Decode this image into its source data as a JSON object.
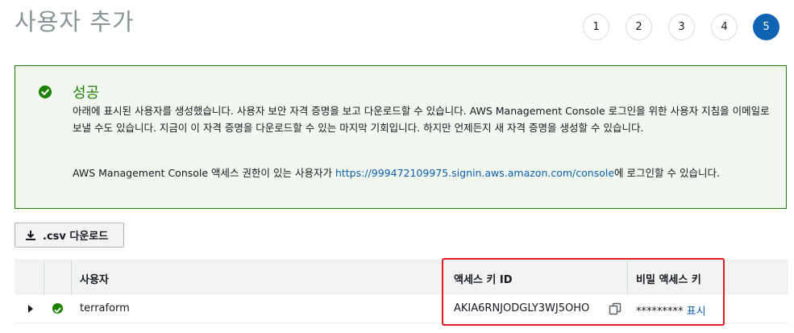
{
  "header": {
    "title": "사용자 추가"
  },
  "steps": [
    {
      "label": "1",
      "active": false
    },
    {
      "label": "2",
      "active": false
    },
    {
      "label": "3",
      "active": false
    },
    {
      "label": "4",
      "active": false
    },
    {
      "label": "5",
      "active": true
    }
  ],
  "alert": {
    "icon": "check-circle-icon",
    "title": "성공",
    "body": "아래에 표시된 사용자를 생성했습니다. 사용자 보안 자격 증명을 보고 다운로드할 수 있습니다. AWS Management Console 로그인을 위한 사용자 지침을 이메일로 보낼 수도 있습니다. 지금이 이 자격 증명을 다운로드할 수 있는 마지막 기회입니다. 하지만 언제든지 새 자격 증명을 생성할 수 있습니다.",
    "console_prefix": "AWS Management Console 액세스 권한이 있는 사용자가 ",
    "console_link": "https://999472109975.signin.aws.amazon.com/console",
    "console_suffix": "에 로그인할 수 있습니다.",
    "color": "#1d8102"
  },
  "toolbar": {
    "csv_label": ".csv 다운로드",
    "csv_icon": "download-icon"
  },
  "table": {
    "columns": {
      "user": "사용자",
      "access_key_id": "액세스 키 ID",
      "secret_key": "비밀 액세스 키"
    },
    "rows": [
      {
        "user": "terraform",
        "access_key_id": "AKIA6RNJODGLY3WJ5OHO",
        "secret_masked": "*********",
        "show_label": "표시"
      }
    ]
  },
  "colors": {
    "accent": "#0f63b3",
    "success": "#1d8102",
    "highlight": "#e31b23"
  }
}
